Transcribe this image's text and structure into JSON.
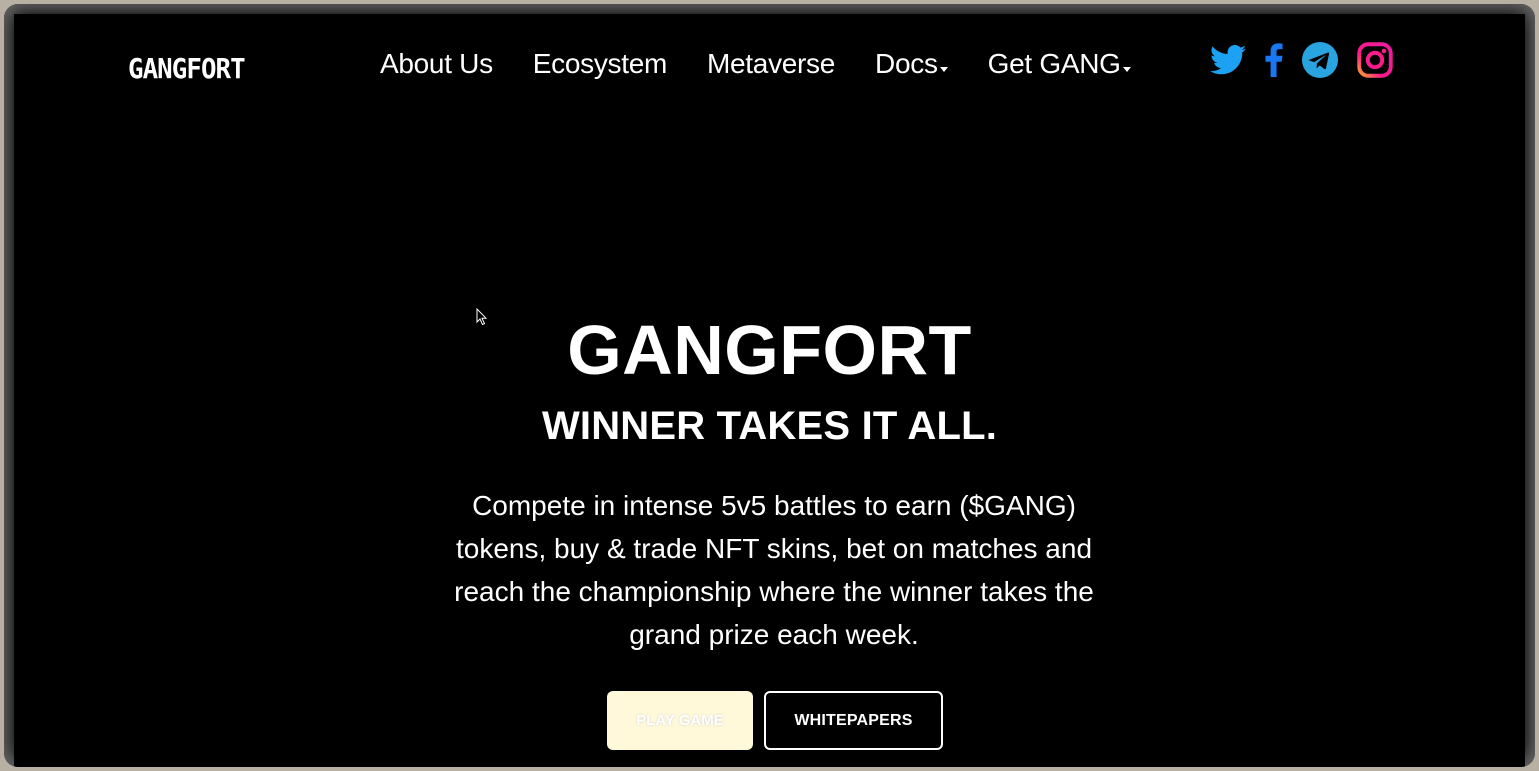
{
  "nav": {
    "logo": "GANGFORT",
    "items": [
      {
        "label": "About Us",
        "dropdown": false
      },
      {
        "label": "Ecosystem",
        "dropdown": false
      },
      {
        "label": "Metaverse",
        "dropdown": false
      },
      {
        "label": "Docs",
        "dropdown": true
      },
      {
        "label": "Get GANG",
        "dropdown": true
      }
    ],
    "social": [
      {
        "icon": "twitter-icon",
        "color": "#1da1f2"
      },
      {
        "icon": "facebook-icon",
        "color": "#1877f2"
      },
      {
        "icon": "telegram-icon",
        "color": "#2aa4e0"
      },
      {
        "icon": "instagram-icon",
        "color": "#e4405f"
      }
    ]
  },
  "hero": {
    "title": "GANGFORT",
    "subtitle": "WINNER TAKES IT ALL.",
    "description": "Compete in intense 5v5 battles to earn ($GANG) tokens, buy & trade NFT skins, bet on matches and reach the championship where the winner takes the grand prize each week.",
    "play_button": "PLAY GAME",
    "whitepapers_button": "WHITEPAPERS"
  },
  "colors": {
    "background": "#000000",
    "text": "#ffffff",
    "play_button_bg": "#fff9d9"
  }
}
